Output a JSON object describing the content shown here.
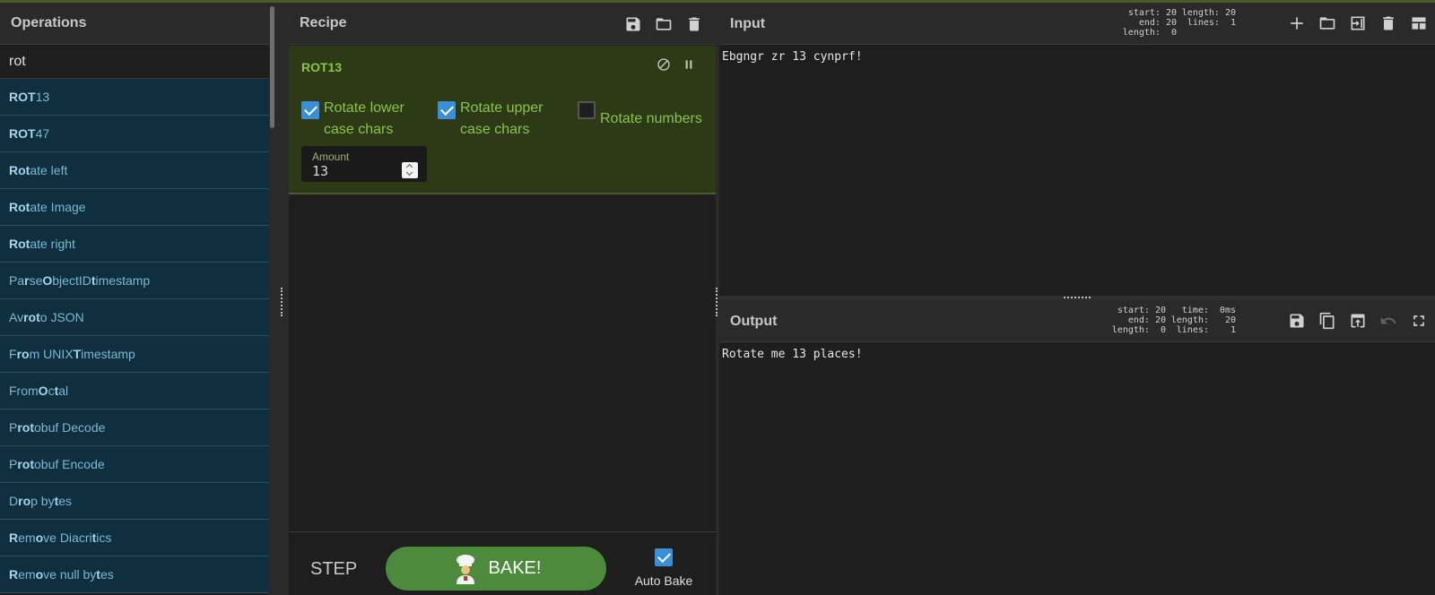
{
  "operations": {
    "title": "Operations",
    "search_value": "rot",
    "items": [
      {
        "parts": [
          {
            "t": "ROT",
            "b": true
          },
          {
            "t": "13",
            "b": false
          }
        ]
      },
      {
        "parts": [
          {
            "t": "ROT",
            "b": true
          },
          {
            "t": "47",
            "b": false
          }
        ]
      },
      {
        "parts": [
          {
            "t": "Rot",
            "b": true
          },
          {
            "t": "ate left",
            "b": false
          }
        ]
      },
      {
        "parts": [
          {
            "t": "Rot",
            "b": true
          },
          {
            "t": "ate Image",
            "b": false
          }
        ]
      },
      {
        "parts": [
          {
            "t": "Rot",
            "b": true
          },
          {
            "t": "ate right",
            "b": false
          }
        ]
      },
      {
        "parts": [
          {
            "t": "Pa",
            "b": false
          },
          {
            "t": "r",
            "b": true
          },
          {
            "t": "se ",
            "b": false
          },
          {
            "t": "O",
            "b": true
          },
          {
            "t": "bjectID ",
            "b": false
          },
          {
            "t": "t",
            "b": true
          },
          {
            "t": "imestamp",
            "b": false
          }
        ]
      },
      {
        "parts": [
          {
            "t": "Av",
            "b": false
          },
          {
            "t": "ro",
            "b": true
          },
          {
            "t": " ",
            "b": false
          },
          {
            "t": "t",
            "b": true
          },
          {
            "t": "o JSON",
            "b": false
          }
        ]
      },
      {
        "parts": [
          {
            "t": "F",
            "b": false
          },
          {
            "t": "ro",
            "b": true
          },
          {
            "t": "m UNIX ",
            "b": false
          },
          {
            "t": "T",
            "b": true
          },
          {
            "t": "imestamp",
            "b": false
          }
        ]
      },
      {
        "parts": [
          {
            "t": "From ",
            "b": false
          },
          {
            "t": "O",
            "b": true
          },
          {
            "t": "c",
            "b": false
          },
          {
            "t": "t",
            "b": true
          },
          {
            "t": "al",
            "b": false
          }
        ]
      },
      {
        "parts": [
          {
            "t": "P",
            "b": false
          },
          {
            "t": "rot",
            "b": true
          },
          {
            "t": "obuf Decode",
            "b": false
          }
        ]
      },
      {
        "parts": [
          {
            "t": "P",
            "b": false
          },
          {
            "t": "rot",
            "b": true
          },
          {
            "t": "obuf Encode",
            "b": false
          }
        ]
      },
      {
        "parts": [
          {
            "t": "D",
            "b": false
          },
          {
            "t": "ro",
            "b": true
          },
          {
            "t": "p by",
            "b": false
          },
          {
            "t": "t",
            "b": true
          },
          {
            "t": "es",
            "b": false
          }
        ]
      },
      {
        "parts": [
          {
            "t": "R",
            "b": true
          },
          {
            "t": "em",
            "b": false
          },
          {
            "t": "o",
            "b": true
          },
          {
            "t": "ve Diacri",
            "b": false
          },
          {
            "t": "t",
            "b": true
          },
          {
            "t": "ics",
            "b": false
          }
        ]
      },
      {
        "parts": [
          {
            "t": "R",
            "b": true
          },
          {
            "t": "em",
            "b": false
          },
          {
            "t": "o",
            "b": true
          },
          {
            "t": "ve null by",
            "b": false
          },
          {
            "t": "t",
            "b": true
          },
          {
            "t": "es",
            "b": false
          }
        ]
      }
    ]
  },
  "recipe": {
    "title": "Recipe",
    "operation": {
      "name": "ROT13",
      "options": {
        "lower": {
          "label_line1": "Rotate lower",
          "label_line2": "case chars",
          "checked": true
        },
        "upper": {
          "label_line1": "Rotate upper",
          "label_line2": "case chars",
          "checked": true
        },
        "numbers": {
          "label": "Rotate numbers",
          "checked": false
        }
      },
      "amount": {
        "label": "Amount",
        "value": "13"
      }
    },
    "step_label": "STEP",
    "bake_label": "BAKE!",
    "autobake": {
      "label": "Auto Bake",
      "checked": true
    }
  },
  "input": {
    "title": "Input",
    "stats_left": "start: 20\n  end: 20\nlength:  0",
    "stats_right": "length: 20\n lines:  1",
    "text": "Ebgngr zr 13 cynprf!"
  },
  "output": {
    "title": "Output",
    "stats_left": "start: 20\n  end: 20\nlength:  0",
    "stats_right": "  time:  0ms\nlength:   20\n lines:    1",
    "text": "Rotate me 13 places!"
  },
  "colors": {
    "accent_green": "#8bc34a",
    "bake_button": "#4b8b3b",
    "operation_item_bg": "#0f2f3e",
    "checkbox_checked": "#3b8fd6"
  }
}
